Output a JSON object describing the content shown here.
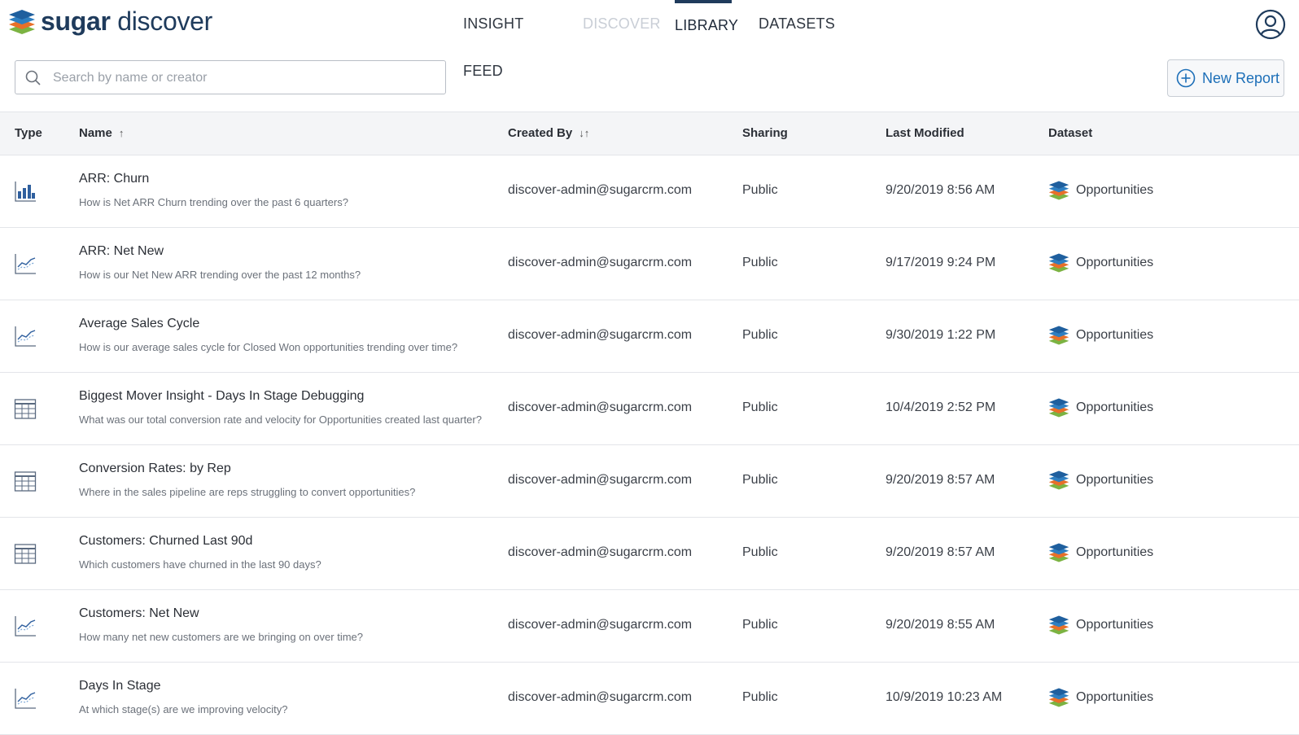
{
  "header": {
    "logo_bold": "sugar",
    "logo_light": "discover",
    "nav": [
      {
        "label": "INSIGHT FEED",
        "state": "normal"
      },
      {
        "label": "DISCOVER",
        "state": "disabled"
      },
      {
        "label": "LIBRARY",
        "state": "active"
      },
      {
        "label": "DATASETS",
        "state": "normal"
      }
    ]
  },
  "search": {
    "placeholder": "Search by name or creator",
    "value": ""
  },
  "toolbar": {
    "new_report_label": "New Report"
  },
  "table": {
    "columns": {
      "type": "Type",
      "name": "Name",
      "created_by": "Created By",
      "sharing": "Sharing",
      "last_modified": "Last Modified",
      "dataset": "Dataset"
    },
    "rows": [
      {
        "icon": "bar-chart-icon",
        "name": "ARR: Churn",
        "description": "How is Net ARR Churn trending over the past 6 quarters?",
        "created_by": "discover-admin@sugarcrm.com",
        "sharing": "Public",
        "last_modified": "9/20/2019 8:56 AM",
        "dataset": "Opportunities"
      },
      {
        "icon": "line-chart-icon",
        "name": "ARR: Net New",
        "description": "How is our Net New ARR trending over the past 12 months?",
        "created_by": "discover-admin@sugarcrm.com",
        "sharing": "Public",
        "last_modified": "9/17/2019 9:24 PM",
        "dataset": "Opportunities"
      },
      {
        "icon": "line-chart-icon",
        "name": "Average Sales Cycle",
        "description": "How is our average sales cycle for Closed Won opportunities trending over time?",
        "created_by": "discover-admin@sugarcrm.com",
        "sharing": "Public",
        "last_modified": "9/30/2019 1:22 PM",
        "dataset": "Opportunities"
      },
      {
        "icon": "table-icon",
        "name": "Biggest Mover Insight - Days In Stage Debugging",
        "description": "What was our total conversion rate and velocity for Opportunities created last quarter?",
        "created_by": "discover-admin@sugarcrm.com",
        "sharing": "Public",
        "last_modified": "10/4/2019 2:52 PM",
        "dataset": "Opportunities"
      },
      {
        "icon": "table-icon",
        "name": "Conversion Rates: by Rep",
        "description": "Where in the sales pipeline are reps struggling to convert opportunities?",
        "created_by": "discover-admin@sugarcrm.com",
        "sharing": "Public",
        "last_modified": "9/20/2019 8:57 AM",
        "dataset": "Opportunities"
      },
      {
        "icon": "table-icon",
        "name": "Customers: Churned Last 90d",
        "description": "Which customers have churned in the last 90 days?",
        "created_by": "discover-admin@sugarcrm.com",
        "sharing": "Public",
        "last_modified": "9/20/2019 8:57 AM",
        "dataset": "Opportunities"
      },
      {
        "icon": "line-chart-icon",
        "name": "Customers: Net New",
        "description": "How many net new customers are we bringing on over time?",
        "created_by": "discover-admin@sugarcrm.com",
        "sharing": "Public",
        "last_modified": "9/20/2019 8:55 AM",
        "dataset": "Opportunities"
      },
      {
        "icon": "line-chart-icon",
        "name": "Days In Stage",
        "description": "At which stage(s) are we improving velocity?",
        "created_by": "discover-admin@sugarcrm.com",
        "sharing": "Public",
        "last_modified": "10/9/2019 10:23 AM",
        "dataset": "Opportunities"
      }
    ]
  },
  "colors": {
    "brand": "#1f3b5c",
    "accent": "#1d6fb8",
    "layer_top": "#2f7fc1",
    "layer_mid": "#e8702a",
    "layer_bottom": "#7cb342"
  }
}
